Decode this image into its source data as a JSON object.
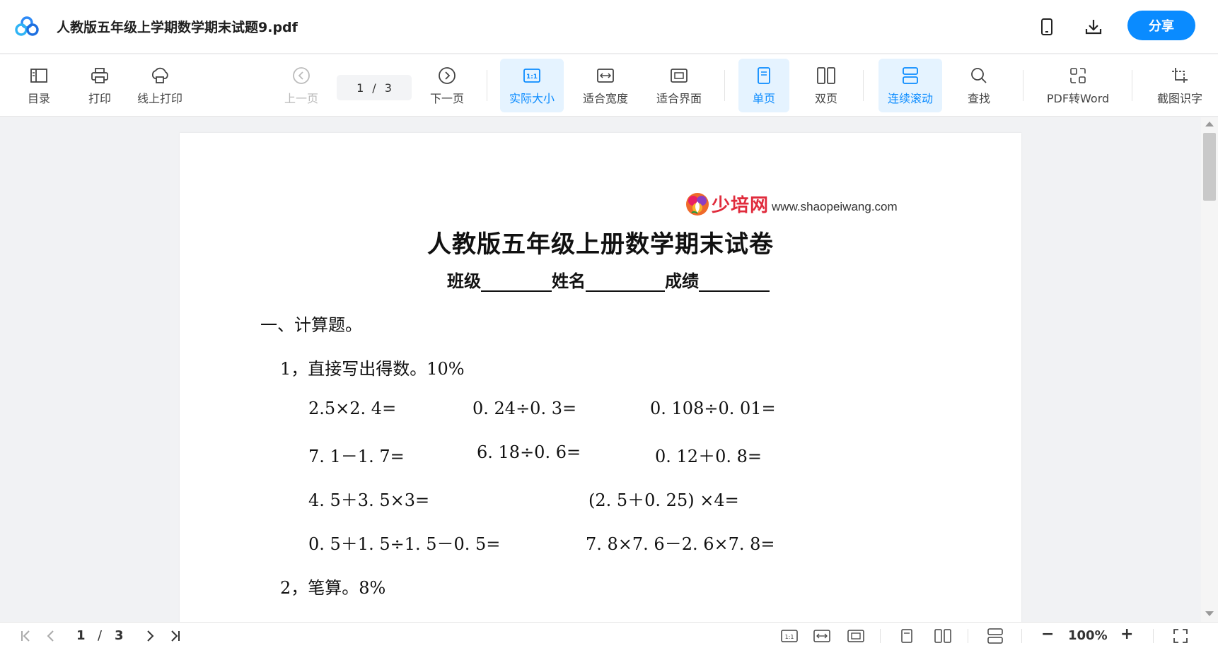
{
  "titlebar": {
    "document_title": "人教版五年级上学期数学期末试题9.pdf",
    "share_label": "分享",
    "icons": [
      "app-logo",
      "mobile-icon",
      "download-icon"
    ]
  },
  "toolbar": {
    "toc": "目录",
    "print": "打印",
    "online_print": "线上打印",
    "prev_page": "上一页",
    "page_current": "1",
    "page_separator": "/",
    "page_total": "3",
    "next_page": "下一页",
    "actual_size": "实际大小",
    "fit_width": "适合宽度",
    "fit_page": "适合界面",
    "single_page": "单页",
    "double_page": "双页",
    "continuous_scroll": "连续滚动",
    "search": "查找",
    "pdf_to_word": "PDF转Word",
    "screenshot_ocr": "截图识字",
    "active_color": "#0a8bff"
  },
  "document": {
    "watermark_brand": "少培网",
    "watermark_url": "www.shaopeiwang.com",
    "exam_title": "人教版五年级上册数学期末试卷",
    "field_class": "班级",
    "field_name": "姓名",
    "field_score": "成绩",
    "section1": "一、计算题。",
    "q1_heading": "1，直接写出得数。10%",
    "row1": [
      "2.5×2. 4=",
      "0. 24÷0. 3=",
      "0. 108÷0. 01="
    ],
    "row2": [
      "7. 1－1. 7=",
      "6. 18÷0. 6=",
      "0. 12＋0. 8="
    ],
    "row3": [
      "4. 5＋3. 5×3=",
      "(2. 5＋0. 25) ×4="
    ],
    "row4": [
      "0. 5＋1. 5÷1. 5－0. 5=",
      "7. 8×7. 6－2. 6×7. 8="
    ],
    "q2_heading": "2，笔算。8%"
  },
  "bottombar": {
    "page_current": "1",
    "page_separator": "/",
    "page_total": "3",
    "zoom": "100%",
    "zoom_minus": "−",
    "zoom_plus": "+"
  }
}
